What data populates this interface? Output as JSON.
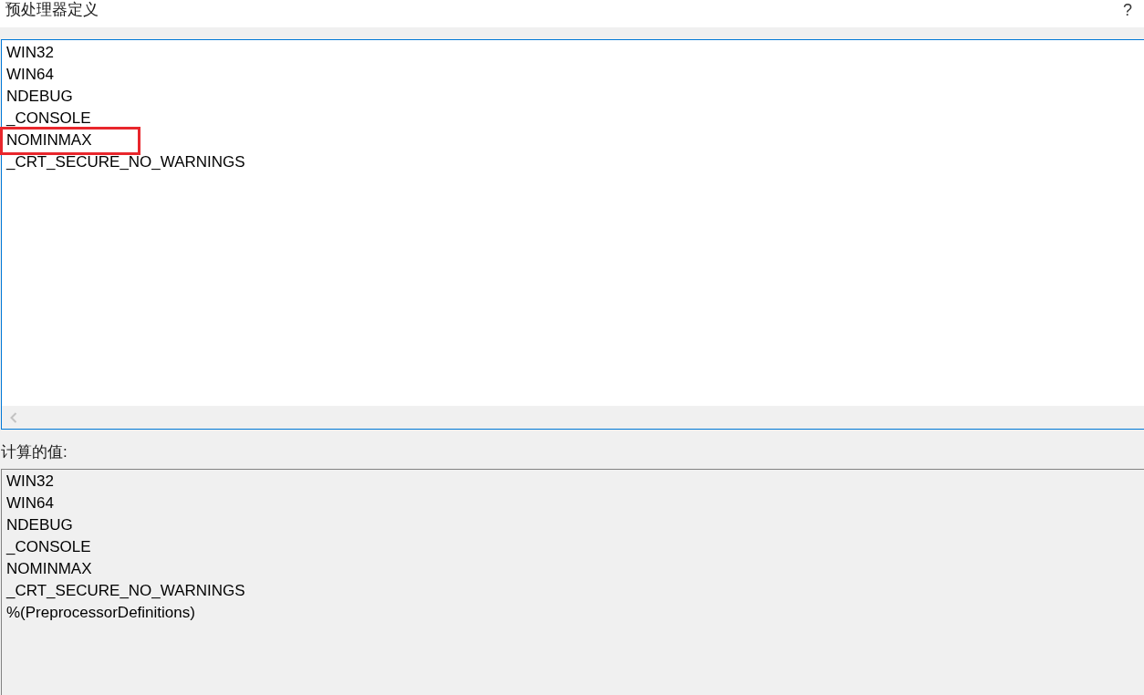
{
  "dialog": {
    "title": "预处理器定义",
    "help_button": "?"
  },
  "definitions_editor": {
    "lines": [
      {
        "text": "WIN32",
        "highlighted": false
      },
      {
        "text": "WIN64",
        "highlighted": false
      },
      {
        "text": "NDEBUG",
        "highlighted": false
      },
      {
        "text": "_CONSOLE",
        "highlighted": false
      },
      {
        "text": "NOMINMAX",
        "highlighted": true
      },
      {
        "text": "_CRT_SECURE_NO_WARNINGS",
        "highlighted": false
      }
    ]
  },
  "computed_values": {
    "label": "计算的值:",
    "lines": [
      "WIN32",
      "WIN64",
      "NDEBUG",
      "_CONSOLE",
      "NOMINMAX",
      "_CRT_SECURE_NO_WARNINGS",
      "%(PreprocessorDefinitions)"
    ]
  }
}
